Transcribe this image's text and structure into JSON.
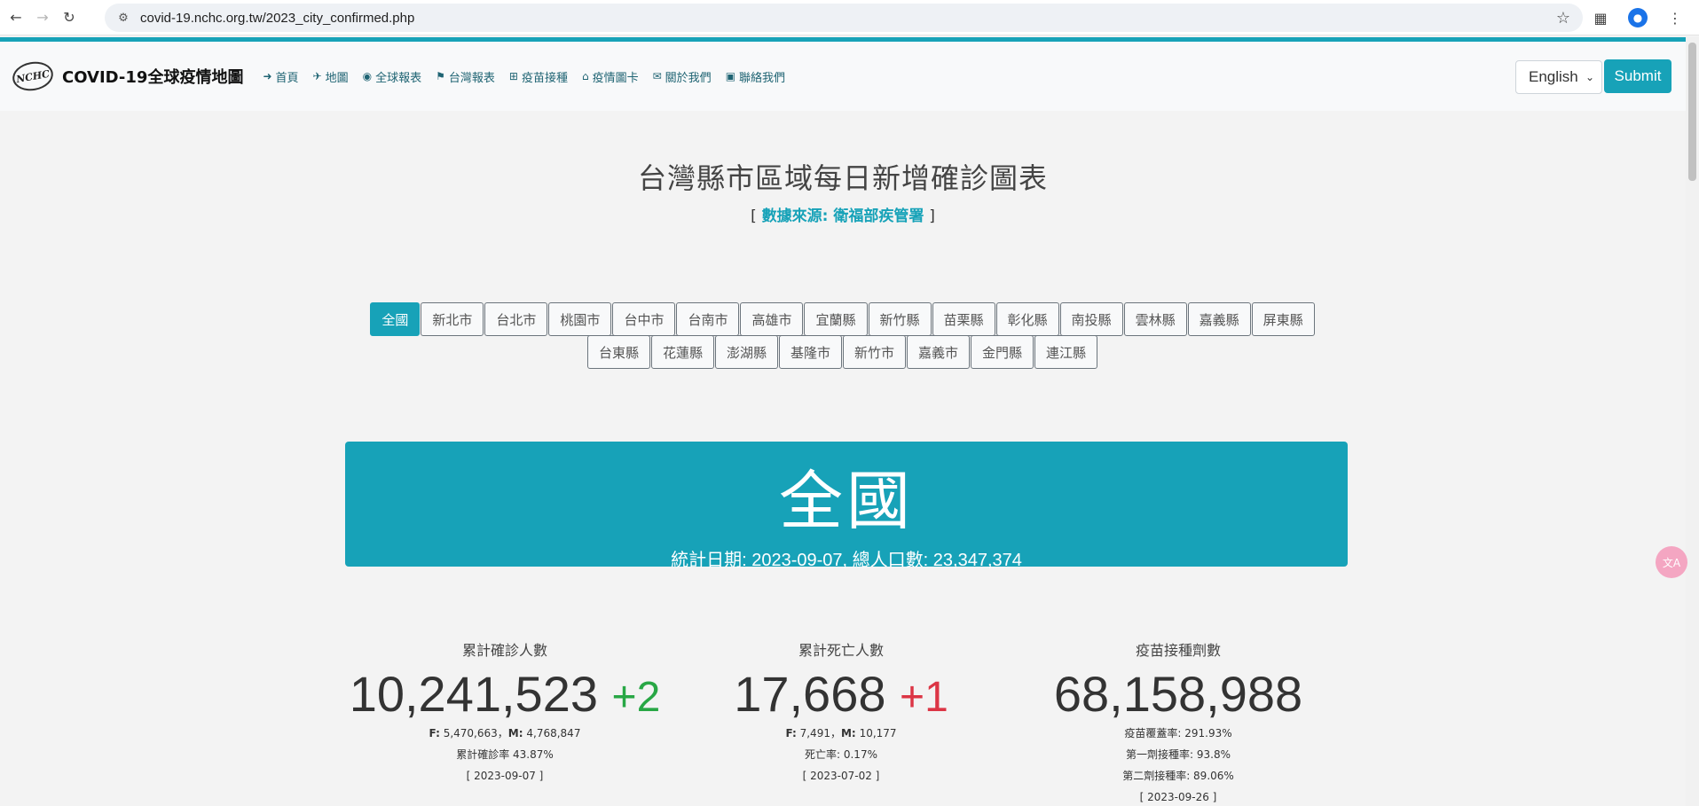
{
  "browser": {
    "url": "covid-19.nchc.org.tw/2023_city_confirmed.php"
  },
  "navbar": {
    "logo_text": "NCHC",
    "brand": "COVID-19全球疫情地圖",
    "links": [
      {
        "label": "首頁",
        "icon": "arrow-right-icon"
      },
      {
        "label": "地圖",
        "icon": "plane-icon"
      },
      {
        "label": "全球報表",
        "icon": "globe-icon"
      },
      {
        "label": "台灣報表",
        "icon": "flag-icon"
      },
      {
        "label": "疫苗接種",
        "icon": "plus-square-icon"
      },
      {
        "label": "疫情圖卡",
        "icon": "bank-icon"
      },
      {
        "label": "關於我們",
        "icon": "envelope-open-icon"
      },
      {
        "label": "聯絡我們",
        "icon": "camera-icon"
      }
    ],
    "language": "English",
    "submit": "Submit"
  },
  "page": {
    "title": "台灣縣市區域每日新增確診圖表",
    "source_open": "[",
    "source": "數據來源: 衛福部疾管署",
    "source_close": "]"
  },
  "cities_row1": [
    "全國",
    "新北市",
    "台北市",
    "桃園市",
    "台中市",
    "台南市",
    "高雄市",
    "宜蘭縣",
    "新竹縣",
    "苗栗縣",
    "彰化縣",
    "南投縣",
    "雲林縣",
    "嘉義縣",
    "屏東縣"
  ],
  "cities_row2": [
    "台東縣",
    "花蓮縣",
    "澎湖縣",
    "基隆市",
    "新竹市",
    "嘉義市",
    "金門縣",
    "連江縣"
  ],
  "banner": {
    "title": "全國",
    "subtitle": "統計日期: 2023-09-07, 總人口數: 23,347,374"
  },
  "stats": {
    "confirmed": {
      "label": "累計確診人數",
      "value": "10,241,523",
      "delta": "+2",
      "f_label": "F:",
      "f_value": "5,470,663",
      "m_label": "M:",
      "m_value": "4,768,847",
      "rate": "累計確診率 43.87%",
      "date": "[ 2023-09-07 ]"
    },
    "deaths": {
      "label": "累計死亡人數",
      "value": "17,668",
      "delta": "+1",
      "f_label": "F:",
      "f_value": "7,491",
      "m_label": "M:",
      "m_value": "10,177",
      "rate": "死亡率: 0.17%",
      "date": "[ 2023-07-02 ]"
    },
    "vaccine": {
      "label": "疫苗接種劑數",
      "value": "68,158,988",
      "coverage": "疫苗覆蓋率: 291.93%",
      "dose1": "第一劑接種率: 93.8%",
      "dose2": "第二劑接種率: 89.06%",
      "date": "[ 2023-09-26 ]"
    }
  },
  "colors": {
    "accent": "#17a2b8",
    "up_green": "#28a745",
    "up_red": "#dc3545"
  }
}
